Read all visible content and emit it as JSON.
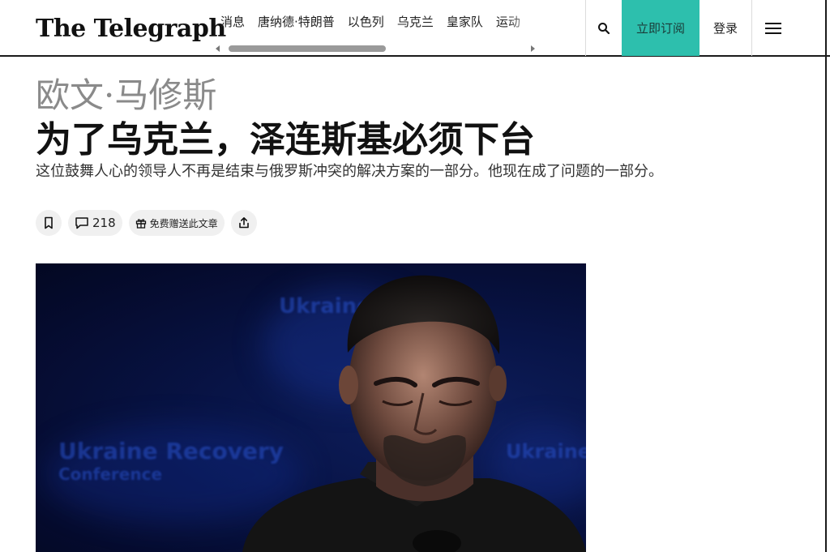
{
  "header": {
    "logo": "The Telegraph",
    "nav": [
      "消息",
      "唐纳德·特朗普",
      "以色列",
      "乌克兰",
      "皇家队",
      "运动"
    ],
    "subscribe": "立即订阅",
    "login": "登录",
    "icons": {
      "search": "search-icon",
      "menu": "hamburger-menu-icon",
      "scroll_left": "triangle-left-icon",
      "scroll_right": "triangle-right-icon"
    },
    "accent_color": "#2dbfad"
  },
  "article": {
    "author": "欧文·马修斯",
    "headline": "为了乌克兰，泽连斯基必须下台",
    "standfirst": "这位鼓舞人心的领导人不再是结束与俄罗斯冲突的解决方案的一部分。他现在成了问题的一部分。",
    "actions": {
      "bookmark_icon": "bookmark-icon",
      "comments_icon": "comment-icon",
      "comments_count": "218",
      "gift_icon": "gift-icon",
      "gift_label": "免费赠送此文章",
      "share_icon": "share-icon"
    },
    "photo": {
      "backdrop_text_large": "Ukraine Recovery",
      "backdrop_text_small": "Conference",
      "backdrop_text_right": "Ukraine",
      "backdrop_text_top": "Ukraine"
    }
  }
}
